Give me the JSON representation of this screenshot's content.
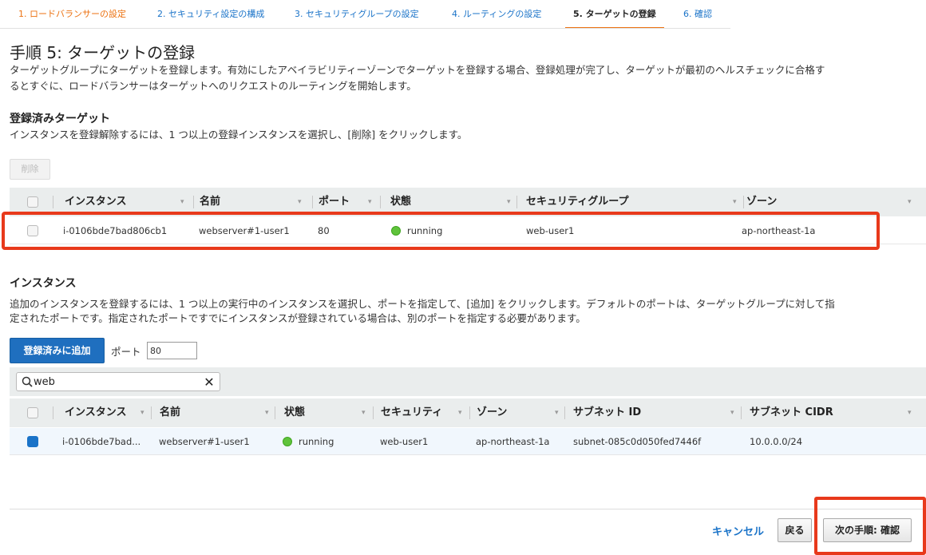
{
  "steps": [
    {
      "label": "1. ロードバランサーの設定"
    },
    {
      "label": "2. セキュリティ設定の構成"
    },
    {
      "label": "3. セキュリティグループの設定"
    },
    {
      "label": "4. ルーティングの設定"
    },
    {
      "label": "5. ターゲットの登録"
    },
    {
      "label": "6. 確認"
    }
  ],
  "page": {
    "title": "手順 5: ターゲットの登録",
    "desc_line1": "ターゲットグループにターゲットを登録します。有効にしたアベイラビリティーゾーンでターゲットを登録する場合、登録処理が完了し、ターゲットが最初のヘルスチェックに合格す",
    "desc_line2": "るとすぐに、ロードバランサーはターゲットへのリクエストのルーティングを開始します。"
  },
  "registered": {
    "title": "登録済みターゲット",
    "desc": "インスタンスを登録解除するには、1 つ以上の登録インスタンスを選択し、[削除] をクリックします。",
    "remove_label": "削除",
    "columns": [
      "インスタンス",
      "名前",
      "ポート",
      "状態",
      "セキュリティグループ",
      "ゾーン"
    ],
    "rows": [
      {
        "instance": "i-0106bde7bad806cb1",
        "name": "webserver#1-user1",
        "port": "80",
        "status": "running",
        "sg": "web-user1",
        "zone": "ap-northeast-1a"
      }
    ]
  },
  "instances": {
    "title": "インスタンス",
    "desc_line1": "追加のインスタンスを登録するには、1 つ以上の実行中のインスタンスを選択し、ポートを指定して、[追加] をクリックします。デフォルトのポートは、ターゲットグループに対して指",
    "desc_line2": "定されたポートです。指定されたポートですでにインスタンスが登録されている場合は、別のポートを指定する必要があります。",
    "add_label": "登録済みに追加",
    "port_label": "ポート",
    "port_value": "80",
    "search_value": "web",
    "columns": [
      "インスタンス",
      "名前",
      "状態",
      "セキュリティ",
      "ゾーン",
      "サブネット ID",
      "サブネット CIDR"
    ],
    "rows": [
      {
        "instance": "i-0106bde7bad...",
        "name": "webserver#1-user1",
        "status": "running",
        "sg": "web-user1",
        "zone": "ap-northeast-1a",
        "subnet": "subnet-085c0d050fed7446f",
        "cidr": "10.0.0.0/24"
      }
    ]
  },
  "footer": {
    "cancel": "キャンセル",
    "back": "戻る",
    "next": "次の手順: 確認"
  },
  "colors": {
    "accent": "#ec7211",
    "link": "#1a73c8",
    "primary_button": "#1f6fbf",
    "highlight": "#e8391b",
    "status_running": "#5fc33b"
  }
}
